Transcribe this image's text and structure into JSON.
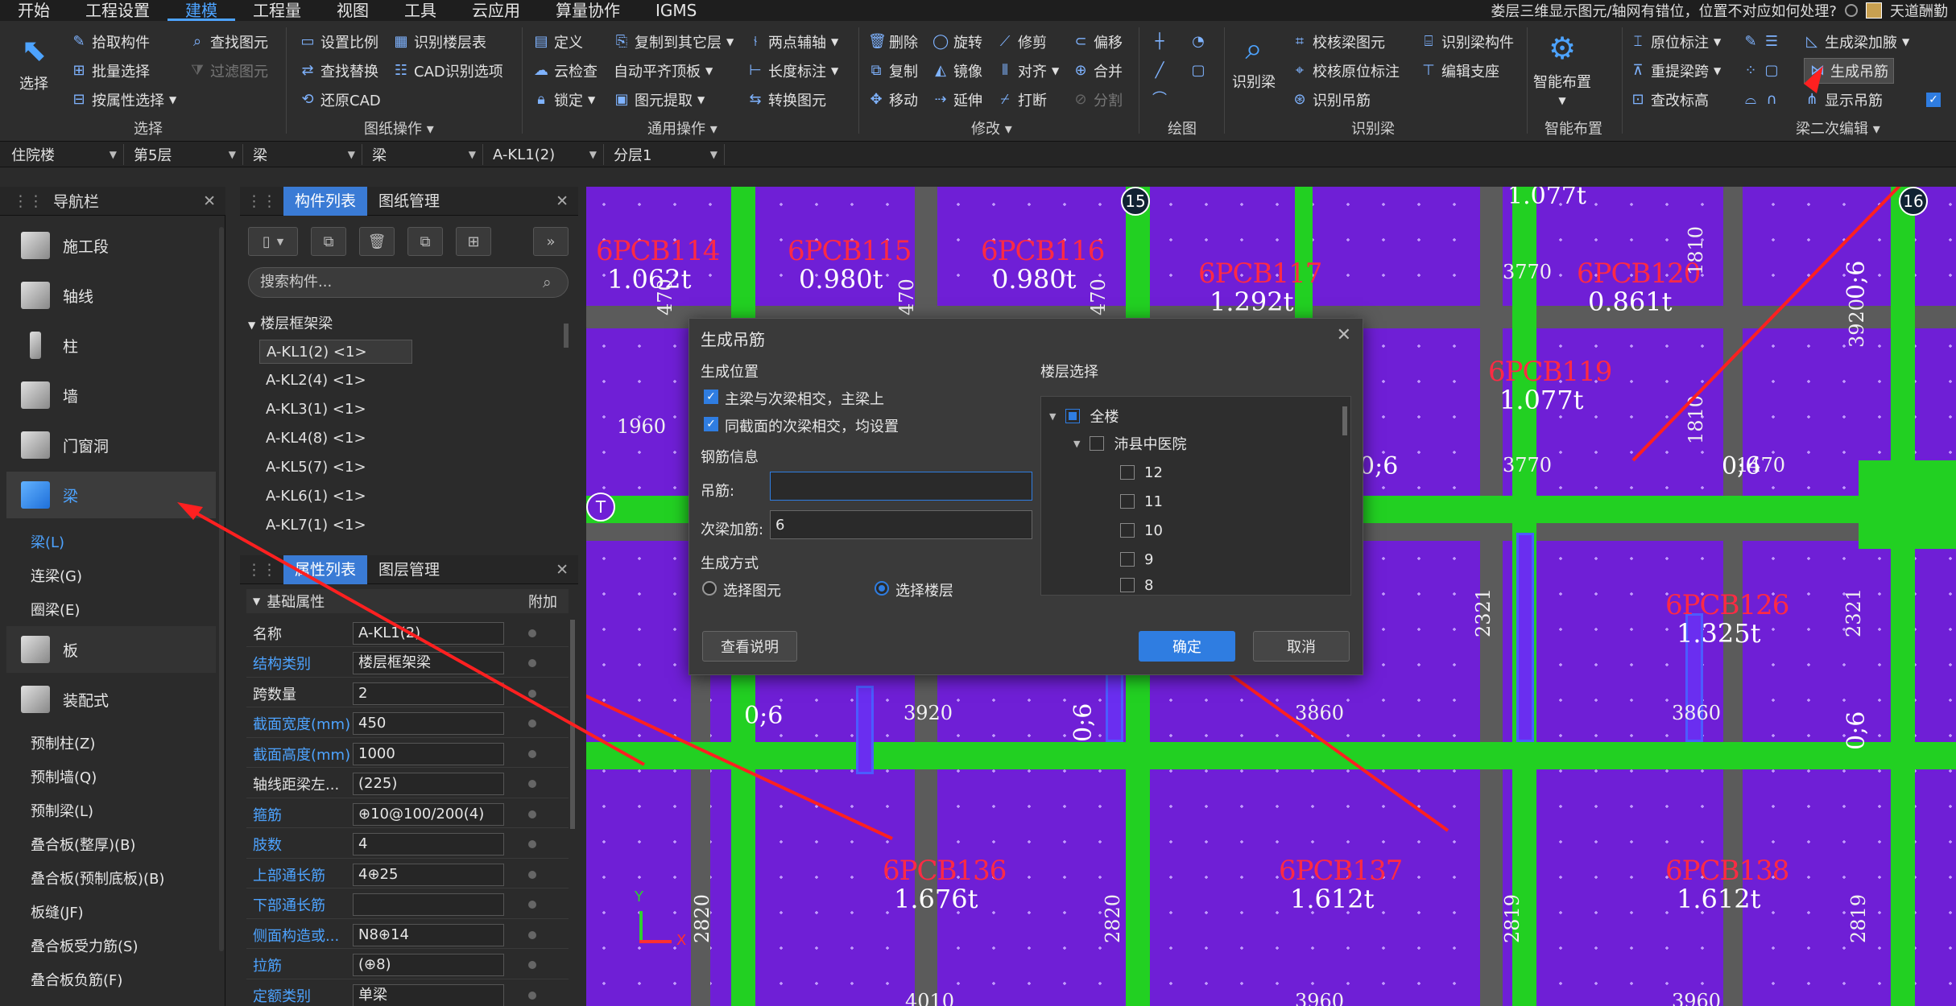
{
  "menu": {
    "items": [
      "开始",
      "工程设置",
      "建模",
      "工程量",
      "视图",
      "工具",
      "云应用",
      "算量协作",
      "IGMS"
    ],
    "active_index": 2,
    "notice": "娄层三维显示图元/轴网有错位，位置不对应如何处理?",
    "user": "天道酬勤"
  },
  "ribbon": {
    "select": {
      "big": "选择",
      "pick": "拾取构件",
      "batch": "批量选择",
      "by_attr": "按属性选择",
      "group": "选择"
    },
    "find": {
      "find_elem": "查找图元",
      "filter_elem": "过滤图元"
    },
    "drawing": {
      "set_scale": "设置比例",
      "find_replace": "查找替换",
      "restore_cad": "还原CAD",
      "identify_floor_table": "识别楼层表",
      "cad_options": "CAD识别选项",
      "group": "图纸操作"
    },
    "general": {
      "define": "定义",
      "cloud_check": "云检查",
      "lock": "锁定",
      "copy_floor": "复制到其它层",
      "auto_level": "自动平齐顶板",
      "extract": "图元提取",
      "two_point_axis": "两点辅轴",
      "length_dim": "长度标注",
      "convert": "转换图元",
      "group": "通用操作"
    },
    "modify": {
      "delete": "删除",
      "copy": "复制",
      "move": "移动",
      "rotate": "旋转",
      "mirror": "镜像",
      "extend": "延伸",
      "trim": "修剪",
      "align": "对齐",
      "break": "打断",
      "offset": "偏移",
      "merge": "合并",
      "split": "分割",
      "group": "修改"
    },
    "draw": {
      "group": "绘图"
    },
    "identify_beam": {
      "big": "识别梁",
      "check_beam": "校核梁图元",
      "check_annotation": "校核原位标注",
      "identify_hanger": "识别吊筋",
      "identify_component": "识别梁构件",
      "edit_support": "编辑支座",
      "group": "识别梁"
    },
    "smart": {
      "big": "智能布置",
      "group": "智能布置"
    },
    "beam_edit": {
      "in_situ": "原位标注",
      "re_span": "重提梁跨",
      "check_elev": "查改标高",
      "gen_add": "生成梁加腋",
      "gen_hanger": "生成吊筋",
      "show_hanger": "显示吊筋",
      "group": "梁二次编辑"
    }
  },
  "selectors": [
    "住院楼",
    "第5层",
    "梁",
    "梁",
    "A-KL1(2)",
    "分层1"
  ],
  "nav": {
    "title": "导航栏",
    "items": [
      {
        "label": "施工段",
        "icon": "segment-icon"
      },
      {
        "label": "轴线",
        "icon": "grid-icon"
      },
      {
        "label": "柱",
        "icon": "column-icon"
      },
      {
        "label": "墙",
        "icon": "wall-icon"
      },
      {
        "label": "门窗洞",
        "icon": "door-icon"
      },
      {
        "label": "梁",
        "icon": "beam-icon"
      }
    ],
    "beam_sub": [
      "梁(L)",
      "连梁(G)",
      "圈梁(E)"
    ],
    "items2": [
      {
        "label": "板",
        "icon": "slab-icon"
      },
      {
        "label": "装配式",
        "icon": "prefab-icon"
      }
    ],
    "prefab_sub": [
      "预制柱(Z)",
      "预制墙(Q)",
      "预制梁(L)",
      "叠合板(整厚)(B)",
      "叠合板(预制底板)(B)",
      "板缝(JF)",
      "叠合板受力筋(S)",
      "叠合板负筋(F)"
    ]
  },
  "components": {
    "tabs": [
      "构件列表",
      "图纸管理"
    ],
    "search_placeholder": "搜索构件...",
    "tree_header": "楼层框架梁",
    "items": [
      "A-KL1(2) <1>",
      "A-KL2(4) <1>",
      "A-KL3(1) <1>",
      "A-KL4(8) <1>",
      "A-KL5(7) <1>",
      "A-KL6(1) <1>",
      "A-KL7(1) <1>"
    ]
  },
  "props": {
    "tabs": [
      "属性列表",
      "图层管理"
    ],
    "header": "基础属性",
    "extra_col": "附加",
    "rows": [
      {
        "name": "名称",
        "value": "A-KL1(2)",
        "blue": false
      },
      {
        "name": "结构类别",
        "value": "楼层框架梁",
        "blue": true
      },
      {
        "name": "跨数量",
        "value": "2",
        "blue": false
      },
      {
        "name": "截面宽度(mm)",
        "value": "450",
        "blue": true
      },
      {
        "name": "截面高度(mm)",
        "value": "1000",
        "blue": true
      },
      {
        "name": "轴线距梁左...",
        "value": "(225)",
        "blue": false
      },
      {
        "name": "箍筋",
        "value": "⊕10@100/200(4)",
        "blue": true
      },
      {
        "name": "肢数",
        "value": "4",
        "blue": true
      },
      {
        "name": "上部通长筋",
        "value": "4⊕25",
        "blue": true
      },
      {
        "name": "下部通长筋",
        "value": "",
        "blue": true
      },
      {
        "name": "侧面构造或...",
        "value": "N8⊕14",
        "blue": true
      },
      {
        "name": "拉筋",
        "value": "(⊕8)",
        "blue": true
      },
      {
        "name": "定额类别",
        "value": "单梁",
        "blue": true
      }
    ]
  },
  "canvas": {
    "labels": [
      {
        "code": "6PCB114",
        "weight": "1.062t"
      },
      {
        "code": "6PCB115",
        "weight": "0.980t"
      },
      {
        "code": "6PCB116",
        "weight": "0.980t"
      },
      {
        "code": "6PCB117",
        "weight": "1.292t"
      },
      {
        "code": "6PCB120",
        "weight": "0.861t"
      },
      {
        "code": "6PCB119",
        "weight": "1.077t"
      },
      {
        "code": "6PCB126",
        "weight": "1.325t"
      },
      {
        "code": "6PCB136",
        "weight": "1.676t"
      },
      {
        "code": "6PCB137",
        "weight": "1.612t"
      },
      {
        "code": "6PCB138",
        "weight": "1.612t"
      }
    ],
    "top_weight": "1.077t",
    "dims": [
      "1960",
      "3770",
      "3770",
      "1470",
      "3920",
      "3860",
      "3860",
      "4010",
      "3960",
      "3960"
    ],
    "vdims": [
      "470",
      "470",
      "470",
      "1810",
      "1810",
      "3920",
      "2321",
      "2321",
      "2820",
      "2820",
      "2819",
      "2819"
    ],
    "elev": [
      "0;6",
      "0;6",
      "0;6",
      "0;6",
      "0;6",
      "0;6"
    ],
    "axis_marks": [
      "15",
      "16",
      "T",
      "15",
      "16"
    ],
    "ucs": {
      "x": "X",
      "y": "Y"
    }
  },
  "dialog": {
    "title": "生成吊筋",
    "position_section": "生成位置",
    "opt1": "主梁与次梁相交，主梁上",
    "opt1_checked": true,
    "opt2": "同截面的次梁相交，均设置",
    "opt2_checked": true,
    "rebar_section": "钢筋信息",
    "hanger_label": "吊筋:",
    "hanger_value": "",
    "secondary_label": "次梁加筋:",
    "secondary_value": "6",
    "mode_section": "生成方式",
    "mode_elem": "选择图元",
    "mode_floor": "选择楼层",
    "mode_selected": "floor",
    "floor_section": "楼层选择",
    "floors": [
      "全楼",
      "沛县中医院",
      "12",
      "11",
      "10",
      "9",
      "8"
    ],
    "help_button": "查看说明",
    "ok_button": "确定",
    "cancel_button": "取消"
  },
  "colors": {
    "accent": "#2f7de1",
    "annotation_red": "#ff2020",
    "canvas_purple": "#6f1fd6",
    "beam_green": "#22d022"
  }
}
